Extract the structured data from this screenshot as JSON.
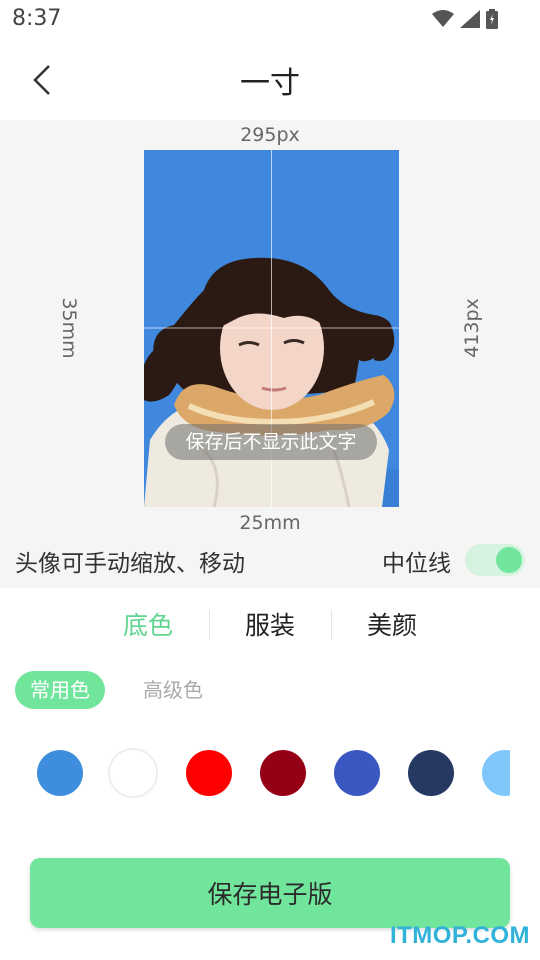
{
  "status_bar": {
    "time": "8:37",
    "icons": [
      "wifi-icon",
      "signal-icon",
      "battery-icon"
    ]
  },
  "app_bar": {
    "title": "一寸",
    "back_icon": "chevron-left-icon"
  },
  "preview": {
    "width_px": "295px",
    "height_px": "413px",
    "width_mm": "25mm",
    "height_mm": "35mm",
    "overlay_text": "保存后不显示此文字",
    "background_color": "#3f88dd"
  },
  "controls": {
    "hint": "头像可手动缩放、移动",
    "midline_label": "中位线",
    "midline_on": true
  },
  "tabs": [
    {
      "label": "底色",
      "active": true
    },
    {
      "label": "服装",
      "active": false
    },
    {
      "label": "美颜",
      "active": false
    }
  ],
  "color_groups": [
    {
      "label": "常用色",
      "active": true
    },
    {
      "label": "高级色",
      "active": false
    }
  ],
  "swatches": [
    "#3f8ddd",
    "#ffffff",
    "#ff0000",
    "#950017",
    "#3b57c2",
    "#263962",
    "#7fc7fb"
  ],
  "save_button": "保存电子版",
  "brand_watermark": "ITMOP.COM",
  "colors": {
    "accent": "#72e59c",
    "accent_text": "#5fd58f"
  }
}
